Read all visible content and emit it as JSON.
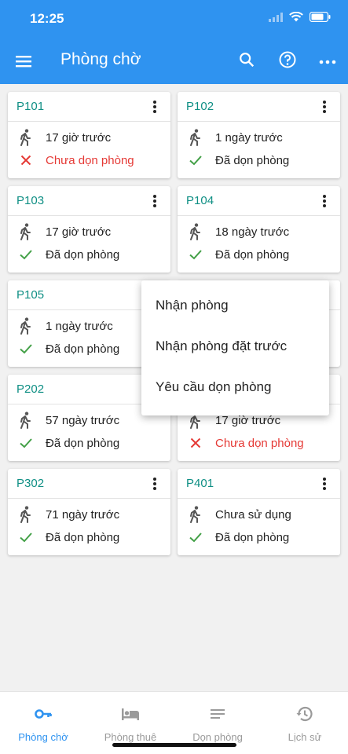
{
  "status_bar": {
    "time": "12:25"
  },
  "header": {
    "title": "Phòng chờ"
  },
  "rooms": [
    {
      "name": "P101",
      "time": "17 giờ trước",
      "state": "Chưa dọn phòng",
      "clean": false
    },
    {
      "name": "P102",
      "time": "1 ngày trước",
      "state": "Đã dọn phòng",
      "clean": true
    },
    {
      "name": "P103",
      "time": "17 giờ trước",
      "state": "Đã dọn phòng",
      "clean": true
    },
    {
      "name": "P104",
      "time": "18 ngày trước",
      "state": "Đã dọn phòng",
      "clean": true
    },
    {
      "name": "P105",
      "time": "1 ngày trước",
      "state": "Đã dọn phòng",
      "clean": true
    },
    {
      "name": "",
      "time": "",
      "state": "",
      "clean": true
    },
    {
      "name": "P202",
      "time": "57 ngày trước",
      "state": "Đã dọn phòng",
      "clean": true
    },
    {
      "name": "",
      "time": "17 giờ trước",
      "state": "Chưa dọn phòng",
      "clean": false
    },
    {
      "name": "P302",
      "time": "71 ngày trước",
      "state": "Đã dọn phòng",
      "clean": true
    },
    {
      "name": "P401",
      "time": "Chưa sử dụng",
      "state": "Đã dọn phòng",
      "clean": true
    }
  ],
  "popup_menu": [
    "Nhận phòng",
    "Nhận phòng đặt trước",
    "Yêu cầu dọn phòng"
  ],
  "bottom_nav": [
    {
      "label": "Phòng chờ",
      "icon": "key-icon",
      "active": true
    },
    {
      "label": "Phòng thuê",
      "icon": "bed-icon",
      "active": false
    },
    {
      "label": "Dọn phòng",
      "icon": "list-icon",
      "active": false
    },
    {
      "label": "Lịch sử",
      "icon": "history-icon",
      "active": false
    }
  ],
  "colors": {
    "primary": "#2f93f0",
    "room_text": "#0f8f84",
    "clean_check": "#43a047",
    "dirty": "#e53935"
  }
}
